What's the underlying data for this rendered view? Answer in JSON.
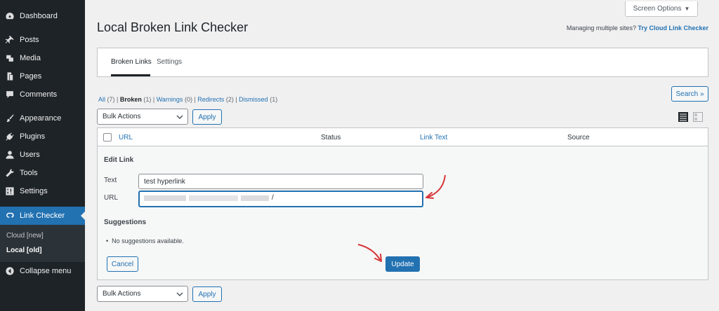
{
  "sidebar": {
    "items": [
      {
        "label": "Dashboard",
        "icon": "dashboard-icon"
      },
      {
        "label": "Posts",
        "icon": "pin-icon"
      },
      {
        "label": "Media",
        "icon": "media-icon"
      },
      {
        "label": "Pages",
        "icon": "pages-icon"
      },
      {
        "label": "Comments",
        "icon": "comment-icon"
      },
      {
        "label": "Appearance",
        "icon": "brush-icon"
      },
      {
        "label": "Plugins",
        "icon": "plug-icon"
      },
      {
        "label": "Users",
        "icon": "user-icon"
      },
      {
        "label": "Tools",
        "icon": "wrench-icon"
      },
      {
        "label": "Settings",
        "icon": "settings-icon"
      },
      {
        "label": "Link Checker",
        "icon": "link-checker-icon"
      }
    ],
    "submenu": [
      {
        "label": "Cloud [new]"
      },
      {
        "label": "Local [old]"
      }
    ],
    "collapse_label": "Collapse menu"
  },
  "header": {
    "screen_options": "Screen Options",
    "title": "Local Broken Link Checker",
    "managing_text": "Managing multiple sites?",
    "managing_link": "Try Cloud Link Checker"
  },
  "tabs": [
    {
      "label": "Broken Links"
    },
    {
      "label": "Settings"
    }
  ],
  "filters": {
    "all": "All",
    "all_count": "(7)",
    "broken": "Broken",
    "broken_count": "(1)",
    "warnings": "Warnings",
    "warnings_count": "(0)",
    "redirects": "Redirects",
    "redirects_count": "(2)",
    "dismissed": "Dismissed",
    "dismissed_count": "(1)"
  },
  "search_button": "Search »",
  "bulk": {
    "select_value": "Bulk Actions",
    "apply": "Apply"
  },
  "table": {
    "columns": [
      "URL",
      "Status",
      "Link Text",
      "Source"
    ]
  },
  "edit_link": {
    "title": "Edit Link",
    "text_label": "Text",
    "text_value": "test hyperlink",
    "url_label": "URL",
    "url_suffix": "/",
    "suggestions_title": "Suggestions",
    "suggestion_empty": "No suggestions available.",
    "cancel": "Cancel",
    "update": "Update"
  },
  "colors": {
    "accent": "#2271b1",
    "sidebar_bg": "#1d2327",
    "annotation_arrow": "#d63638"
  }
}
